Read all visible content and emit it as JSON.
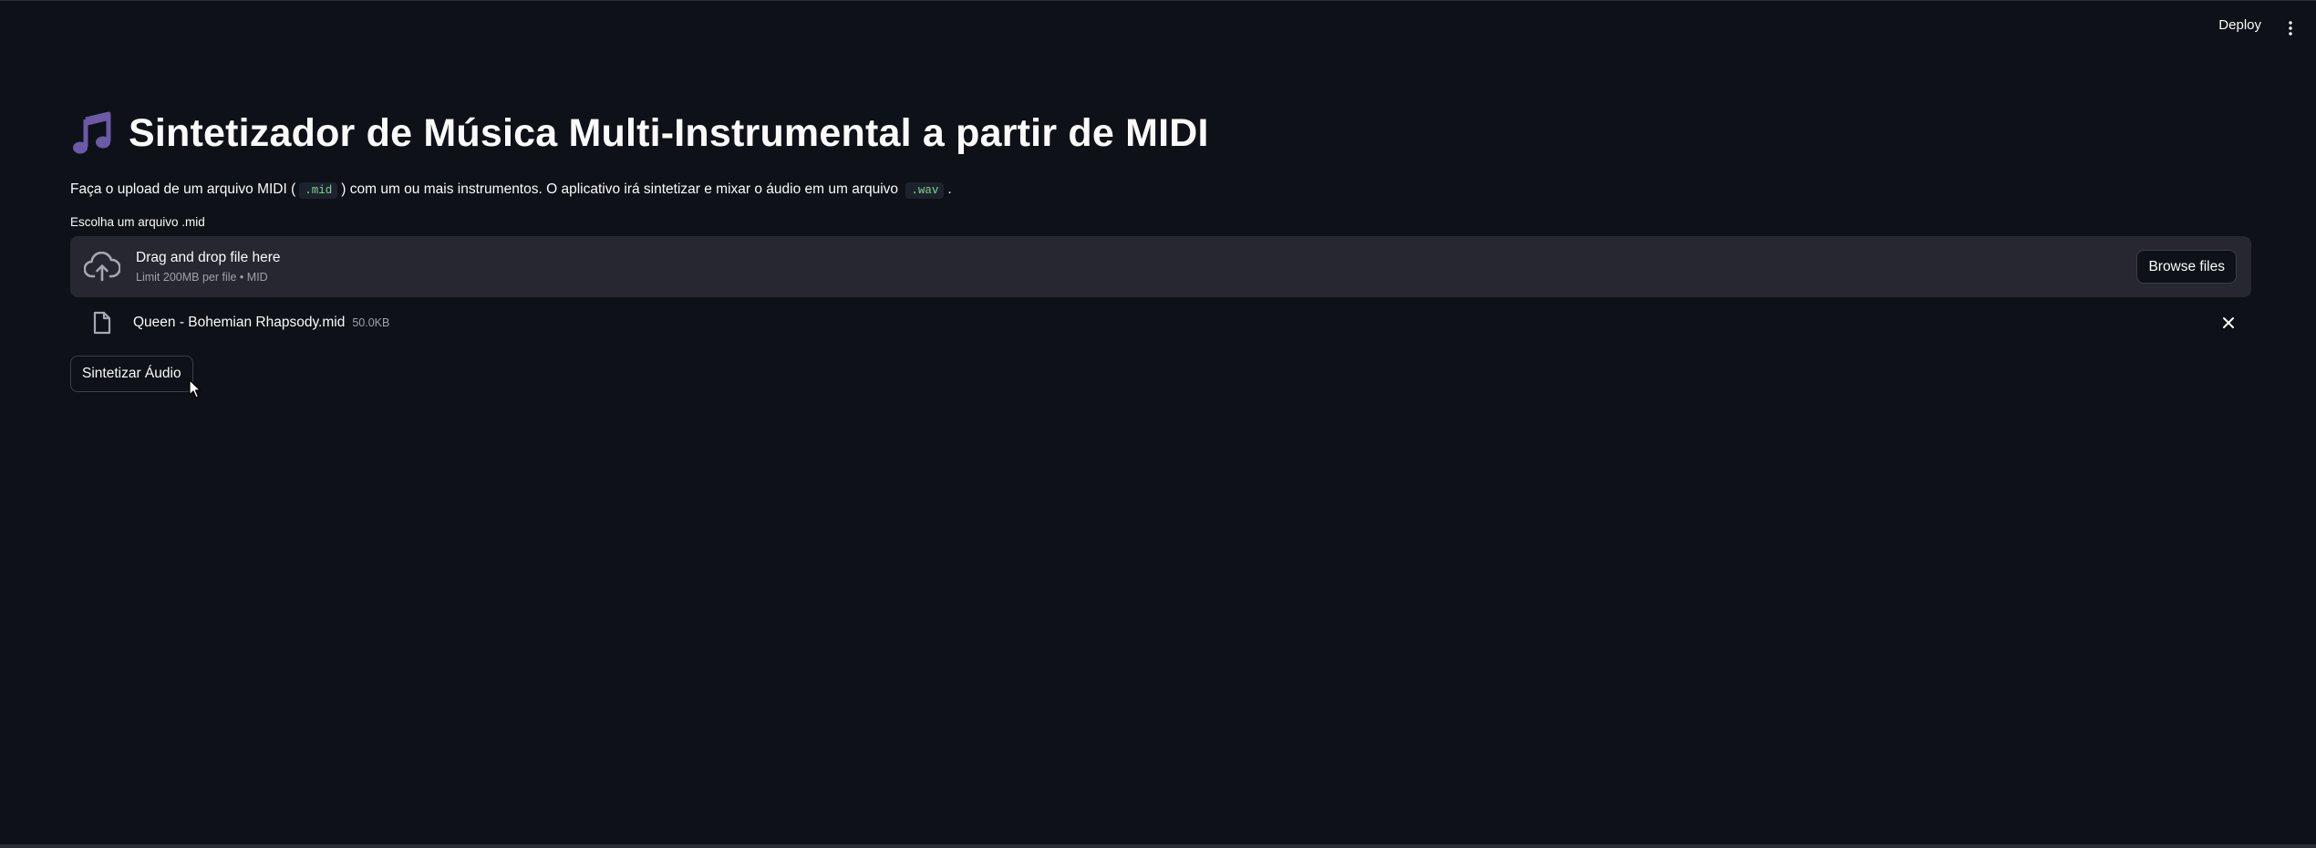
{
  "header": {
    "deploy_label": "Deploy",
    "menu_icon": "kebab-menu-icon"
  },
  "main": {
    "title_icon": "musical-notes-icon",
    "title": "Sintetizador de Música Multi-Instrumental a partir de MIDI",
    "description": {
      "part1": "Faça o upload de um arquivo MIDI (",
      "code1": ".mid",
      "part2": ") com um ou mais instrumentos. O aplicativo irá sintetizar e mixar o áudio em um arquivo",
      "code2": ".wav",
      "part3": "."
    },
    "uploader": {
      "label": "Escolha um arquivo .mid",
      "drop_title": "Drag and drop file here",
      "drop_subtitle": "Limit 200MB per file • MID",
      "browse_label": "Browse files",
      "icon": "cloud-upload-icon"
    },
    "uploaded_file": {
      "name": "Queen - Bohemian Rhapsody.mid",
      "size": "50.0KB",
      "icon": "file-icon"
    },
    "synth_button_label": "Sintetizar Áudio"
  },
  "colors": {
    "background": "#0e1117",
    "dropzone": "#262730",
    "code_text": "#7fd193",
    "note_icon": "#6a5aa8"
  }
}
